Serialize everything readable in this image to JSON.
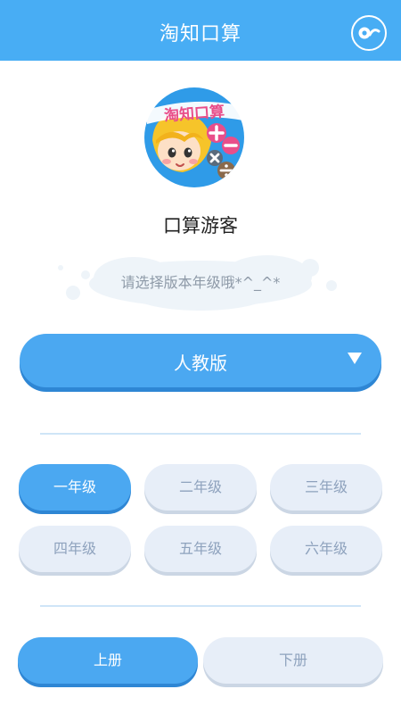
{
  "header": {
    "title": "淘知口算",
    "icon": "toggle-icon"
  },
  "logo": {
    "text": "淘知口算",
    "icon": "app-logo"
  },
  "user": {
    "name": "口算游客"
  },
  "prompt": {
    "text": "请选择版本年级哦*^_^*"
  },
  "edition": {
    "selected": "人教版"
  },
  "grades": [
    "一年级",
    "二年级",
    "三年级",
    "四年级",
    "五年级",
    "六年级"
  ],
  "selected_grade": "一年级",
  "volumes": [
    "上册",
    "下册"
  ],
  "selected_volume": "上册",
  "colors": {
    "primary": "#48adf4",
    "button": "#4ba8f1",
    "inactive_bg": "#e7eef8",
    "inactive_text": "#8ea2bd"
  }
}
